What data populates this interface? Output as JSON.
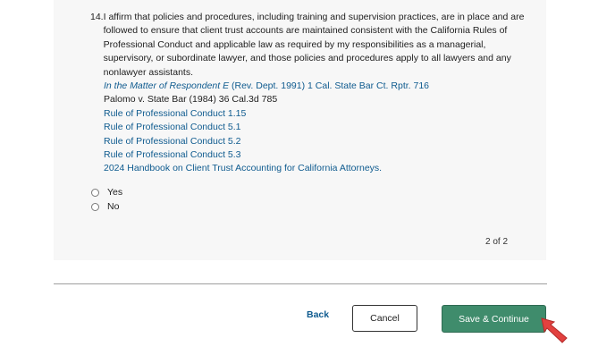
{
  "question": {
    "number": "14.",
    "text": "I affirm that policies and procedures, including training and supervision practices, are in place and are followed to ensure that client trust accounts are maintained consistent with the California Rules of Professional Conduct and applicable law as required by my responsibilities as a managerial, supervisory, or subordinate lawyer, and those policies and procedures apply to all lawyers and any nonlawyer assistants.",
    "references": {
      "ref1_italic": "In the Matter of Respondent E",
      "ref1_rest": " (Rev. Dept. 1991) 1 Cal. State Bar Ct. Rptr. 716",
      "ref2": "Palomo v. State Bar (1984) 36 Cal.3d 785",
      "ref3": "Rule of Professional Conduct 1.15",
      "ref4": "Rule of Professional Conduct 5.1",
      "ref5": "Rule of Professional Conduct 5.2",
      "ref6": "Rule of Professional Conduct 5.3",
      "ref7": "2024 Handbook on Client Trust Accounting for California Attorneys."
    }
  },
  "options": {
    "yes": "Yes",
    "no": "No"
  },
  "pager": "2 of 2",
  "actions": {
    "back": "Back",
    "cancel": "Cancel",
    "save": "Save & Continue"
  },
  "colors": {
    "link": "#0f5b8f",
    "card_bg": "#f7f7f7",
    "save_bg": "#3f8c6c",
    "cursor": "#e2413f"
  },
  "icons": {
    "cursor": "pointer-cursor-icon"
  }
}
